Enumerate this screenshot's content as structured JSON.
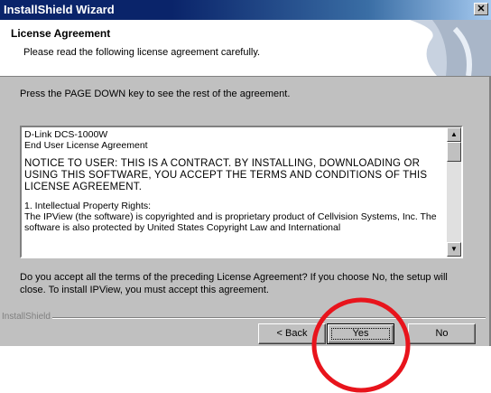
{
  "window": {
    "title": "InstallShield Wizard",
    "close_glyph": "✕"
  },
  "header": {
    "title": "License Agreement",
    "subtitle": "Please read the following license agreement carefully."
  },
  "instruction": "Press the PAGE DOWN key to see the rest of the agreement.",
  "license_text": {
    "line1": "D-Link DCS-1000W",
    "line2": "End User License Agreement",
    "notice": "NOTICE TO USER:  THIS IS A CONTRACT.  BY INSTALLING, DOWNLOADING OR USING THIS SOFTWARE, YOU ACCEPT THE TERMS AND CONDITIONS OF THIS LICENSE AGREEMENT.",
    "section": "1.  Intellectual Property Rights:",
    "body": "The IPView (the software) is copyrighted and is proprietary product of Cellvision Systems, Inc.  The software is also protected by United States Copyright Law and International"
  },
  "scrollbar": {
    "up_glyph": "▲",
    "down_glyph": "▼"
  },
  "question": "Do you accept all the terms of the preceding License Agreement?  If you choose No,  the setup will close.  To install IPView, you must accept this agreement.",
  "brand": "InstallShield",
  "buttons": {
    "back": "< Back",
    "yes": "Yes",
    "no": "No"
  },
  "annotation_color": "#e8141c"
}
